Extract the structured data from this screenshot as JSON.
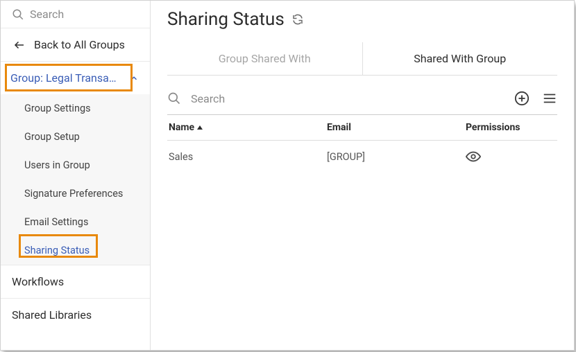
{
  "sidebar": {
    "search_placeholder": "Search",
    "back_label": "Back to All Groups",
    "group_header": "Group: Legal Transacti…",
    "subitems": [
      "Group Settings",
      "Group Setup",
      "Users in Group",
      "Signature Preferences",
      "Email Settings",
      "Sharing Status"
    ],
    "nav": [
      "Workflows",
      "Shared Libraries"
    ]
  },
  "main": {
    "title": "Sharing Status",
    "tabs": [
      "Group Shared With",
      "Shared With Group"
    ],
    "active_tab": 1,
    "search_placeholder": "Search",
    "columns": {
      "name": "Name",
      "email": "Email",
      "permissions": "Permissions"
    },
    "rows": [
      {
        "name": "Sales",
        "email": "[GROUP]",
        "permission_icon": "view"
      }
    ]
  }
}
